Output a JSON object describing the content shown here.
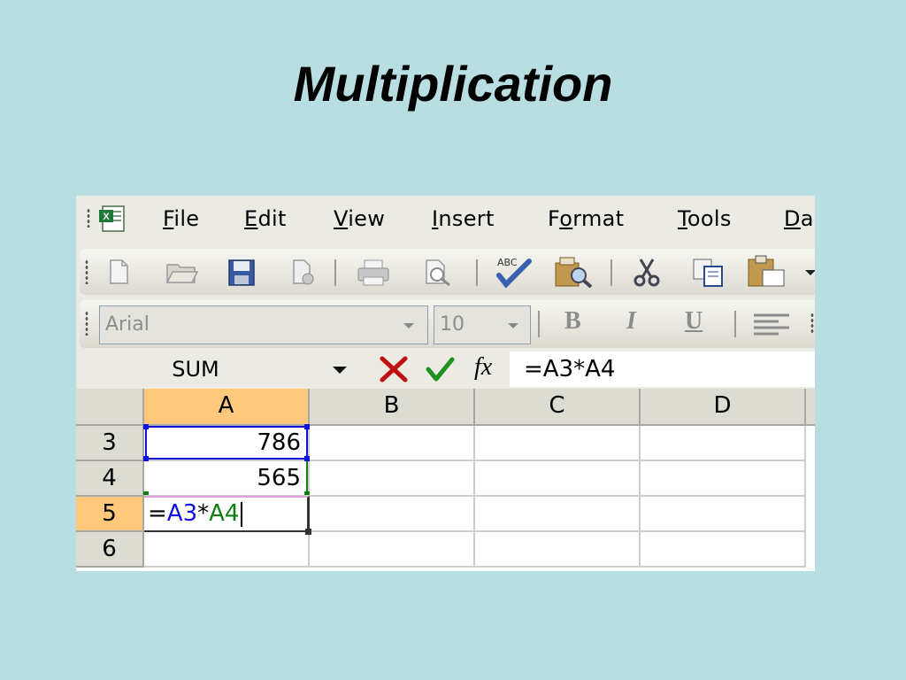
{
  "slide": {
    "title": "Multiplication"
  },
  "menu": {
    "items": [
      {
        "pre": "",
        "acc": "F",
        "post": "ile"
      },
      {
        "pre": "",
        "acc": "E",
        "post": "dit"
      },
      {
        "pre": "",
        "acc": "V",
        "post": "iew"
      },
      {
        "pre": "",
        "acc": "I",
        "post": "nsert"
      },
      {
        "pre": "F",
        "acc": "o",
        "post": "rmat"
      },
      {
        "pre": "",
        "acc": "T",
        "post": "ools"
      },
      {
        "pre": "",
        "acc": "D",
        "post": "a"
      }
    ]
  },
  "formatting": {
    "font": "Arial",
    "size": "10",
    "bold": "B",
    "italic": "I",
    "underline": "U"
  },
  "formula_bar": {
    "name_box": "SUM",
    "fx": "fx",
    "formula": "=A3*A4"
  },
  "sheet": {
    "columns": [
      "A",
      "B",
      "C",
      "D"
    ],
    "active_column": "A",
    "rows": [
      {
        "header": "3",
        "a": "786"
      },
      {
        "header": "4",
        "a": "565"
      },
      {
        "header": "5",
        "a_parts": [
          "=",
          "A3",
          "*",
          "A4"
        ]
      },
      {
        "header": "6",
        "a": ""
      }
    ],
    "colors": {
      "ref1": "#1010e0",
      "ref2": "#108010",
      "active_header": "#ffc87a"
    }
  }
}
